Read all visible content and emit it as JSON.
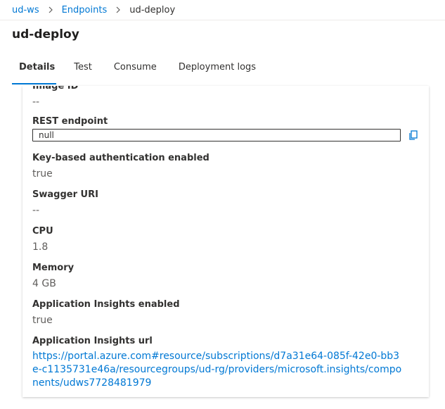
{
  "breadcrumb": {
    "items": [
      "ud-ws",
      "Endpoints"
    ],
    "current": "ud-deploy"
  },
  "page_title": "ud-deploy",
  "tabs": [
    {
      "label": "Details",
      "active": true
    },
    {
      "label": "Test",
      "active": false
    },
    {
      "label": "Consume",
      "active": false
    },
    {
      "label": "Deployment logs",
      "active": false
    }
  ],
  "fields": {
    "image_id": {
      "label": "Image ID",
      "value": "--"
    },
    "rest_endpoint": {
      "label": "REST endpoint",
      "value": "null"
    },
    "key_auth": {
      "label": "Key-based authentication enabled",
      "value": "true"
    },
    "swagger": {
      "label": "Swagger URI",
      "value": "--"
    },
    "cpu": {
      "label": "CPU",
      "value": "1.8"
    },
    "memory": {
      "label": "Memory",
      "value": "4 GB"
    },
    "insights_enabled": {
      "label": "Application Insights enabled",
      "value": "true"
    },
    "insights_url": {
      "label": "Application Insights url",
      "value": "https://portal.azure.com#resource/subscriptions/d7a31e64-085f-42e0-bb3e-c1135731e46a/resourcegroups/ud-rg/providers/microsoft.insights/components/udws7728481979"
    }
  },
  "icons": {
    "copy": "copy-icon",
    "separator": "chevron-right-icon"
  },
  "colors": {
    "accent": "#0078d4",
    "text": "#323130",
    "muted": "#605e5c"
  }
}
